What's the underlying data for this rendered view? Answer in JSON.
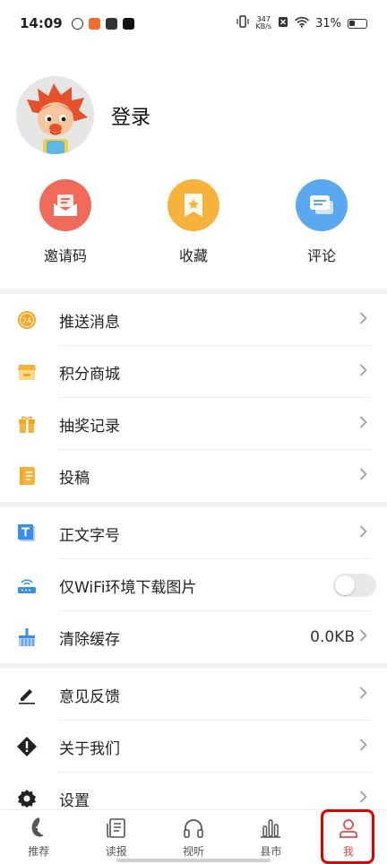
{
  "status_bar": {
    "time": "14:09",
    "net_speed_value": "347",
    "net_speed_unit": "KB/s",
    "battery_percent": "31%"
  },
  "profile": {
    "login_label": "登录"
  },
  "quick_actions": [
    {
      "label": "邀请码",
      "icon": "envelope-icon",
      "color": "#f06a5a"
    },
    {
      "label": "收藏",
      "icon": "bookmark-star-icon",
      "color": "#f7b23b"
    },
    {
      "label": "评论",
      "icon": "chat-bubble-icon",
      "color": "#5aa8f0"
    }
  ],
  "menu_group_1": [
    {
      "label": "推送消息",
      "icon": "push-24-icon"
    },
    {
      "label": "积分商城",
      "icon": "store-icon"
    },
    {
      "label": "抽奖记录",
      "icon": "gift-icon"
    },
    {
      "label": "投稿",
      "icon": "notebook-icon"
    }
  ],
  "menu_group_2": [
    {
      "label": "正文字号",
      "icon": "font-size-icon"
    },
    {
      "label": "仅WiFi环境下载图片",
      "icon": "router-icon",
      "toggle": false
    },
    {
      "label": "清除缓存",
      "icon": "broom-icon",
      "value": "0.0KB"
    }
  ],
  "menu_group_3": [
    {
      "label": "意见反馈",
      "icon": "pencil-icon"
    },
    {
      "label": "关于我们",
      "icon": "info-diamond-icon"
    },
    {
      "label": "设置",
      "icon": "gear-icon"
    }
  ],
  "bottom_nav": [
    {
      "label": "推荐",
      "icon": "recommend-icon"
    },
    {
      "label": "读报",
      "icon": "newspaper-icon"
    },
    {
      "label": "视听",
      "icon": "headphones-icon"
    },
    {
      "label": "县市",
      "icon": "city-icon"
    },
    {
      "label": "我",
      "icon": "person-icon",
      "active": true
    }
  ],
  "colors": {
    "accent": "#e24b4b",
    "highlight_box": "#e00000"
  }
}
